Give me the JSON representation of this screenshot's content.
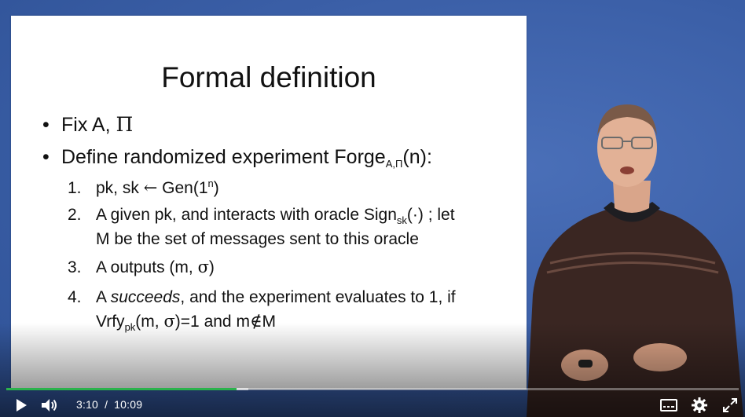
{
  "slide": {
    "title": "Formal definition",
    "bullets": [
      {
        "text": "Fix A, ",
        "symbol": "Π"
      },
      {
        "text": "Define randomized experiment Forge",
        "sub": "A,Π",
        "tail": "(n):"
      }
    ],
    "items": [
      {
        "num": "1.",
        "a": "pk, sk ",
        "arrow": "←",
        "b": " Gen(1",
        "sup": "n",
        "c": ")"
      },
      {
        "num": "2.",
        "a": "A given pk, and interacts with oracle Sign",
        "sub": "sk",
        "b": "(·) ; let",
        "line2": "M be the set of messages sent to this oracle"
      },
      {
        "num": "3.",
        "a": "A outputs (m, ",
        "sigma": "σ",
        "b": ")"
      },
      {
        "num": "4.",
        "a": "A ",
        "em": "succeeds",
        "b": ", and the experiment evaluates to 1, if",
        "line2a": "Vrfy",
        "line2sub": "pk",
        "line2b": "(m, ",
        "line2sigma": "σ",
        "line2c": ")=1 and m",
        "line2notin": "∉",
        "line2d": "M"
      }
    ]
  },
  "player": {
    "current_time": "3:10",
    "separator": "/",
    "duration": "10:09",
    "progress": 0.314,
    "buffered": 0.33,
    "colors": {
      "progress": "#2bb24c",
      "background": "#3f63a8"
    },
    "icons": [
      "play-icon",
      "volume-icon",
      "subtitles-icon",
      "settings-icon",
      "fullscreen-icon"
    ]
  }
}
